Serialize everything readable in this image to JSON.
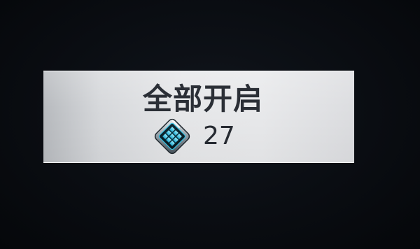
{
  "unlock_all": {
    "label": "全部开启",
    "cost": {
      "icon": "crystal-cube-icon",
      "amount": "27"
    }
  },
  "colors": {
    "background": "#07090d",
    "button_face": "#e6e7e9",
    "text": "#2b2f36",
    "crystal_accent": "#35c3e6"
  }
}
